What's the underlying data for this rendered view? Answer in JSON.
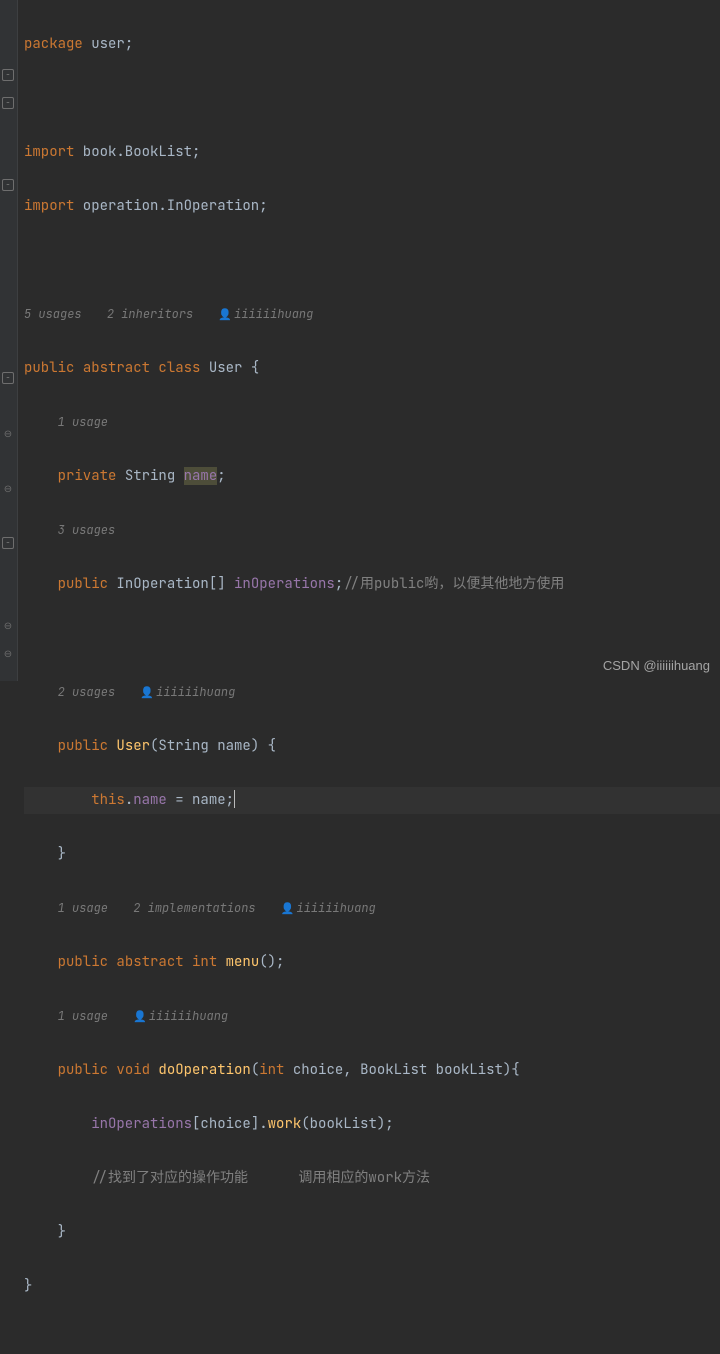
{
  "code": {
    "pkg_kw": "package",
    "pkg_name": " user",
    "semi": ";",
    "import_kw": "import",
    "import1": " book.BookList",
    "import2": " operation.InOperation",
    "hint_usages5": "5 usages",
    "hint_inheritors2": "2 inheritors",
    "hint_author": "iiiiiihuang",
    "public_kw": "public",
    "abstract_kw": "abstract",
    "class_kw": "class",
    "class_name": " User ",
    "lbrace": "{",
    "rbrace": "}",
    "hint_usage1": "1 usage",
    "private_kw": "private",
    "string_type": " String ",
    "name_field": "name",
    "hint_usages3": "3 usages",
    "inop_type": " InOperation[] ",
    "inops_field": "inOperations",
    "comment_pub": "//用public哟，以便其他地方使用",
    "hint_usages2": "2 usages",
    "user_ctor": " User",
    "ctor_params_open": "(",
    "ctor_param_type": "String ",
    "ctor_param_name": "name",
    "ctor_params_close": ") ",
    "this_kw": "this",
    "dot": ".",
    "assign": " = ",
    "hint_impl2": "2 implementations",
    "int_type": " int ",
    "menu_method": "menu",
    "parens": "()",
    "void_kw": " void ",
    "doop_method": "doOperation",
    "doop_p1_type": "int ",
    "doop_p1_name": "choice",
    "comma_sep": ", ",
    "doop_p2_type": "BookList ",
    "doop_p2_name": "bookList",
    "doop_close": ")",
    "lbracket": "[",
    "rbracket": "]",
    "work_method": "work",
    "lparen": "(",
    "rparen": ")",
    "comment_find": "//找到了对应的操作功能      调用相应的work方法"
  },
  "watermark": "CSDN @iiiiiihuang"
}
